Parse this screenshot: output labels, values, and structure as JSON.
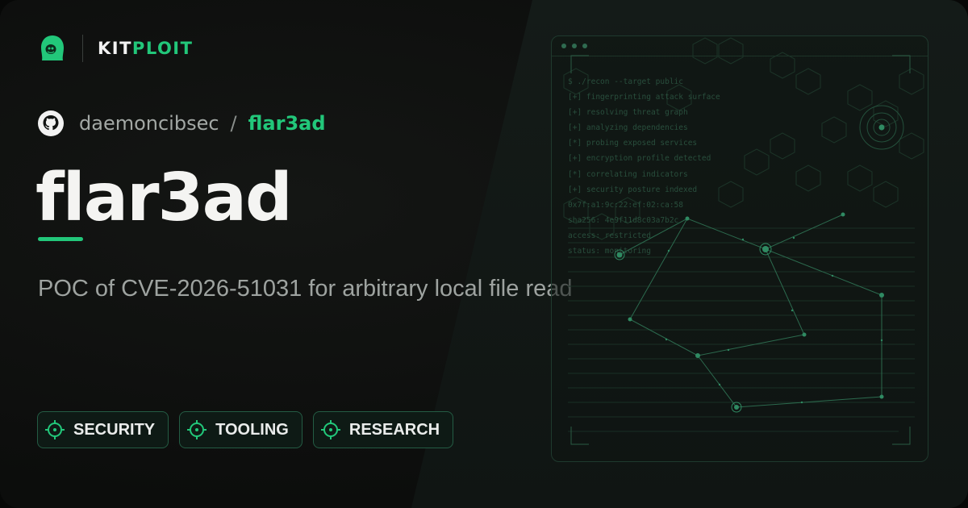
{
  "brand": {
    "name_primary": "KIT",
    "name_accent": "PLOIT",
    "logo_icon": "hooded-figure-icon"
  },
  "repo": {
    "owner": "daemoncibsec",
    "separator": "/",
    "name": "flar3ad",
    "icon": "github-icon"
  },
  "title": "flar3ad",
  "description": "POC of CVE-2026-51031 for arbitrary local file read",
  "tags": [
    {
      "label": "SECURITY",
      "icon": "crosshair-icon"
    },
    {
      "label": "TOOLING",
      "icon": "crosshair-icon"
    },
    {
      "label": "RESEARCH",
      "icon": "crosshair-icon"
    }
  ],
  "terminal": {
    "lines": [
      "$ ./recon --target public",
      "[+] fingerprinting attack surface",
      "[+] resolving threat graph",
      "[+] analyzing dependencies",
      "[*] probing exposed services",
      "[+] encryption profile detected",
      "[*] correlating indicators",
      "[+] security posture indexed",
      "0x7f:a1:9c:22:ef:02:ca:58",
      "sha256: 4e9f11d8c03a7b2c",
      "access: restricted",
      "status: monitoring"
    ]
  },
  "colors": {
    "accent": "#22c77a",
    "background": "#0f1110",
    "text_primary": "#f4f4f2",
    "text_muted": "#9ea3a0"
  }
}
